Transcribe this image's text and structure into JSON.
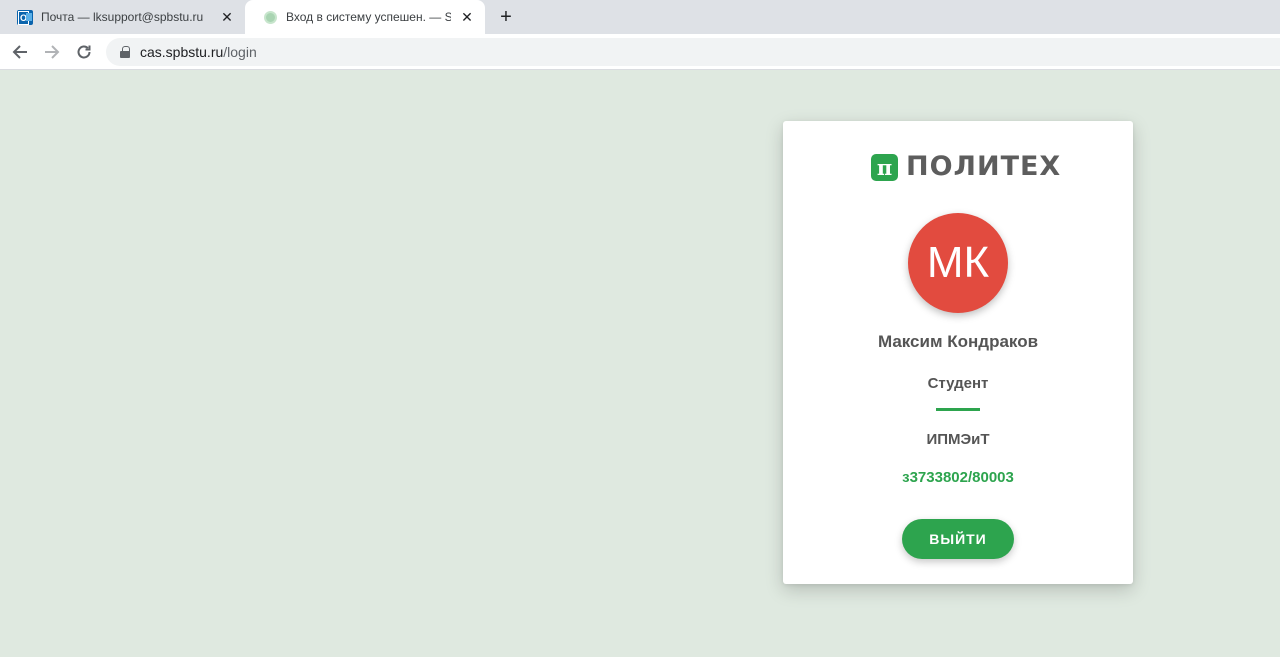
{
  "browser": {
    "tabs": [
      {
        "title": "Почта — lksupport@spbstu.ru",
        "icon": "outlook-icon",
        "active": false
      },
      {
        "title": "Вход в систему успешен. — SSO",
        "icon": "site-favicon",
        "active": true
      }
    ],
    "new_tab_icon": "plus-icon",
    "close_icon": "close-icon",
    "url_host": "cas.spbstu.ru",
    "url_path": "/login"
  },
  "card": {
    "brand_mark": "π",
    "brand_name": "ПОЛИТЕХ",
    "avatar_initials": "МК",
    "user_name": "Максим Кондраков",
    "role": "Студент",
    "department": "ИПМЭиТ",
    "group": "з3733802/80003",
    "logout_label": "ВЫЙТИ"
  },
  "colors": {
    "page_bg": "#dfe9e0",
    "accent": "#2da44e",
    "avatar_bg": "#e24b3f"
  }
}
